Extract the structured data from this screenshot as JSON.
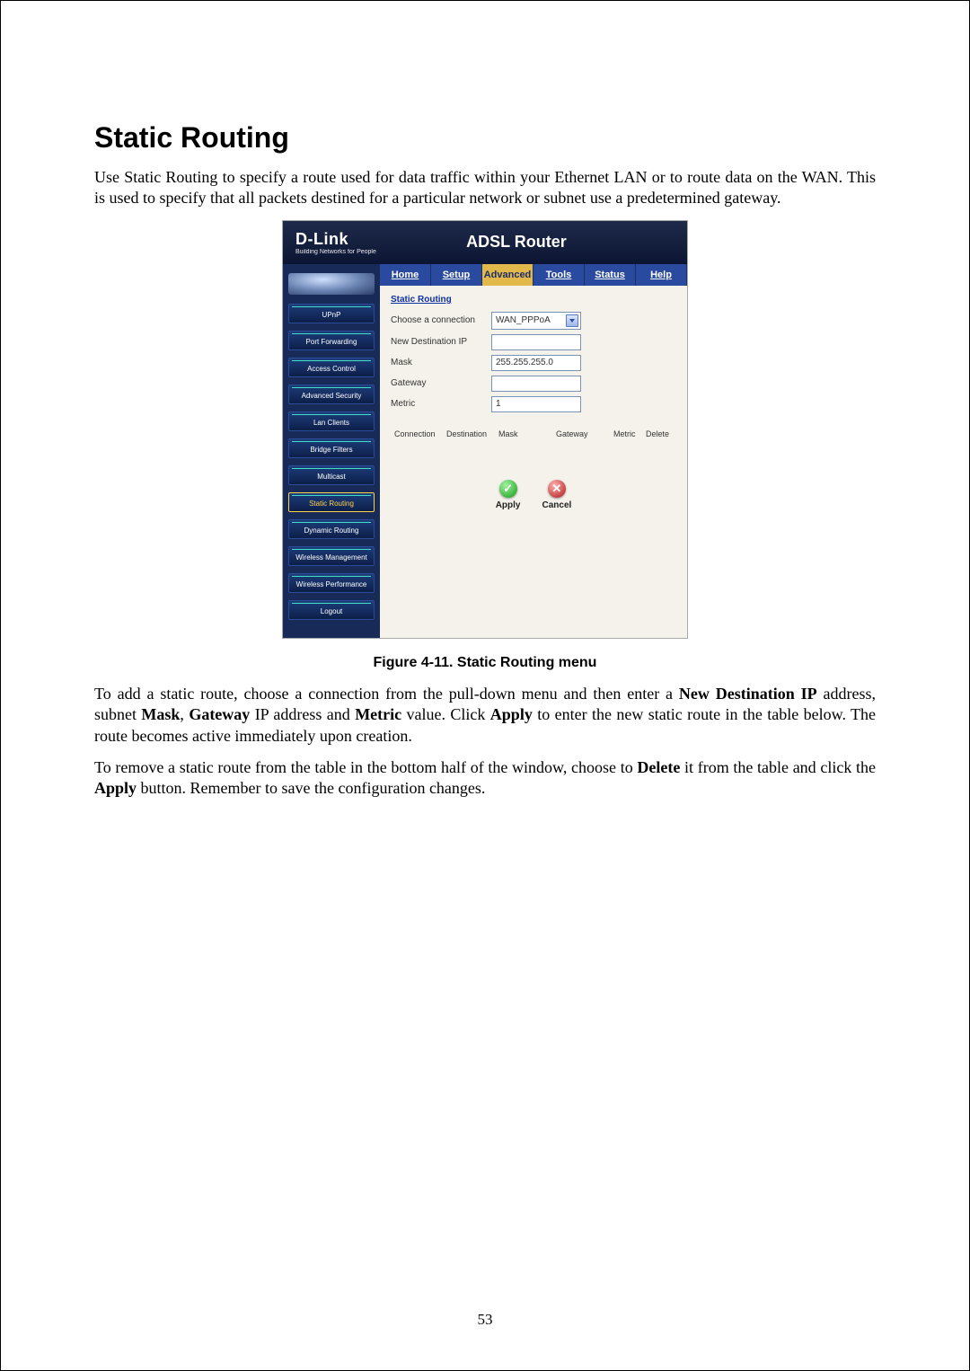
{
  "page": {
    "heading": "Static Routing",
    "intro": "Use Static Routing to specify a route used for data traffic within your Ethernet LAN or to route data on the WAN. This is used to specify that all packets destined for a particular network or subnet use a predetermined gateway.",
    "caption": "Figure 4-11. Static Routing menu",
    "para2_a": "To add a static route, choose a connection from the pull-down menu and then enter a ",
    "para2_b": "New Destination IP",
    "para2_c": " address, subnet ",
    "para2_d": "Mask",
    "para2_e": ", ",
    "para2_f": "Gateway",
    "para2_g": " IP address and ",
    "para2_h": "Metric",
    "para2_i": " value. Click ",
    "para2_j": "Apply",
    "para2_k": " to enter the new static route in the table below. The route becomes active immediately upon creation.",
    "para3_a": "To remove a static route from the table in the bottom half of the window, choose to ",
    "para3_b": "Delete",
    "para3_c": " it from the table and click the ",
    "para3_d": "Apply",
    "para3_e": " button. Remember to save the configuration changes.",
    "number": "53"
  },
  "router": {
    "logo": "D-Link",
    "logo_sub": "Building Networks for People",
    "title": "ADSL Router",
    "tabs": [
      "Home",
      "Setup",
      "Advanced",
      "Tools",
      "Status",
      "Help"
    ],
    "active_tab": "Advanced",
    "side": [
      "UPnP",
      "Port Forwarding",
      "Access Control",
      "Advanced Security",
      "Lan Clients",
      "Bridge Filters",
      "Multicast",
      "Static Routing",
      "Dynamic Routing",
      "Wireless Management",
      "Wireless Performance",
      "Logout"
    ],
    "active_side": "Static Routing",
    "section_title": "Static Routing",
    "form": {
      "choose_label": "Choose a connection",
      "choose_value": "WAN_PPPoA",
      "dest_label": "New Destination IP",
      "dest_value": "",
      "mask_label": "Mask",
      "mask_value": "255.255.255.0",
      "gateway_label": "Gateway",
      "gateway_value": "",
      "metric_label": "Metric",
      "metric_value": "1"
    },
    "table_headers": [
      "Connection",
      "Destination",
      "Mask",
      "Gateway",
      "Metric",
      "Delete"
    ],
    "apply": "Apply",
    "cancel": "Cancel"
  }
}
